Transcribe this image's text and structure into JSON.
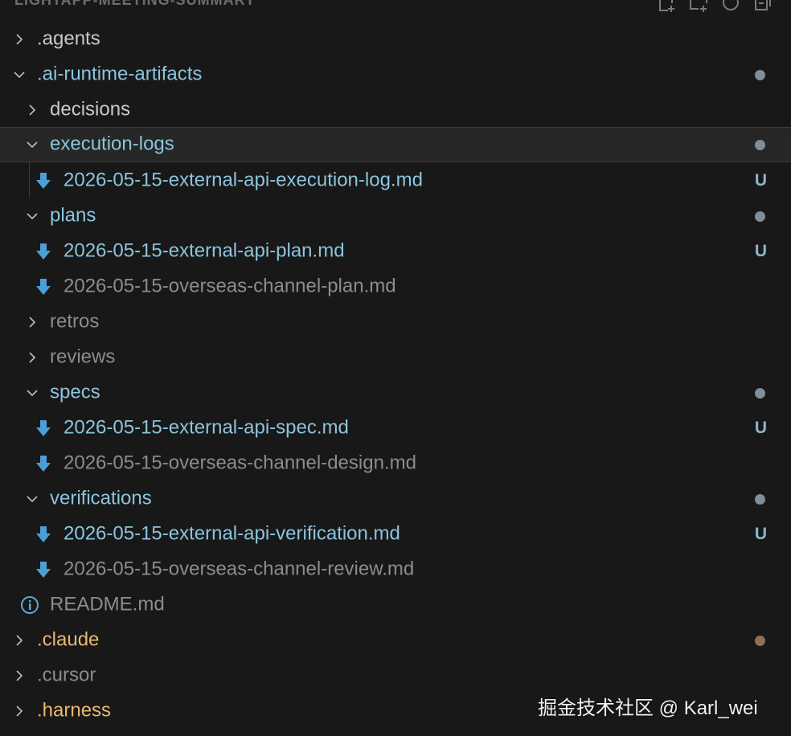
{
  "explorer": {
    "title": "LIGHTAPP-MEETING-SUMMARY",
    "actions": [
      {
        "icon": "new-file-icon"
      },
      {
        "icon": "new-folder-icon"
      },
      {
        "icon": "refresh-icon"
      },
      {
        "icon": "collapse-all-icon"
      }
    ]
  },
  "tree": {
    "agents": {
      "label": ".agents"
    },
    "ai_runtime": {
      "label": ".ai-runtime-artifacts"
    },
    "decisions": {
      "label": "decisions"
    },
    "execution_logs": {
      "label": "execution-logs"
    },
    "execution_log_file": {
      "label": "2026-05-15-external-api-execution-log.md",
      "badge": "U"
    },
    "plans": {
      "label": "plans"
    },
    "plan_file_1": {
      "label": "2026-05-15-external-api-plan.md",
      "badge": "U"
    },
    "plan_file_2": {
      "label": "2026-05-15-overseas-channel-plan.md"
    },
    "retros": {
      "label": "retros"
    },
    "reviews": {
      "label": "reviews"
    },
    "specs": {
      "label": "specs"
    },
    "spec_file_1": {
      "label": "2026-05-15-external-api-spec.md",
      "badge": "U"
    },
    "spec_file_2": {
      "label": "2026-05-15-overseas-channel-design.md"
    },
    "verifications": {
      "label": "verifications"
    },
    "verification_file_1": {
      "label": "2026-05-15-external-api-verification.md",
      "badge": "U"
    },
    "verification_file_2": {
      "label": "2026-05-15-overseas-channel-review.md"
    },
    "readme": {
      "label": "README.md"
    },
    "claude": {
      "label": ".claude"
    },
    "cursor": {
      "label": ".cursor"
    },
    "harness": {
      "label": ".harness"
    }
  },
  "colors": {
    "background": "#181818",
    "modified_text": "#8cc4dd",
    "untracked_badge": "#8cb6cc",
    "ignored_text": "#8c8c8c",
    "warning_text": "#e8b86f"
  },
  "watermark": "掘金技术社区 @ Karl_wei"
}
